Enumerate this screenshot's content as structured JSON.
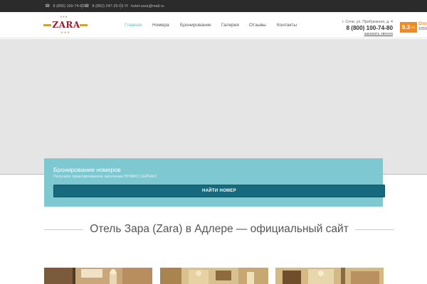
{
  "topbar": {
    "phone1": "8 (800) 100-74-80",
    "phone2": "8 (862) 247-25-55",
    "email": "hotel-zara@mail.ru"
  },
  "header": {
    "logo_text": "ZARA",
    "logo_stars": "★★★",
    "nav": [
      {
        "label": "Главная",
        "active": true
      },
      {
        "label": "Номера",
        "active": false
      },
      {
        "label": "Бронирование",
        "active": false
      },
      {
        "label": "Галерея",
        "active": false
      },
      {
        "label": "Отзывы",
        "active": false
      },
      {
        "label": "Контакты",
        "active": false
      }
    ],
    "address": "г. Сочи, ул. Прибрежная, д. 4",
    "phone": "8 (800) 100-74-80",
    "callback": "заказать звонок",
    "rating": {
      "score": "9.3",
      "scale": "/10",
      "label": "Отл",
      "reviews": "1559"
    }
  },
  "booking": {
    "title": "Бронирование номеров",
    "subtitle": "Получите гарантированное заселение ПРЯМО СЕЙЧАС!",
    "button": "НАЙТИ НОМЕР"
  },
  "section": {
    "title": "Отель Зара (Zara) в Адлере — официальный сайт"
  },
  "colors": {
    "accent": "#58c3cf",
    "booking_bg": "#7ec8d1",
    "button_bg": "#176a7d",
    "rating_bg": "#f08a21",
    "logo_red": "#9b1b2f",
    "logo_gold": "#c9a23a"
  }
}
